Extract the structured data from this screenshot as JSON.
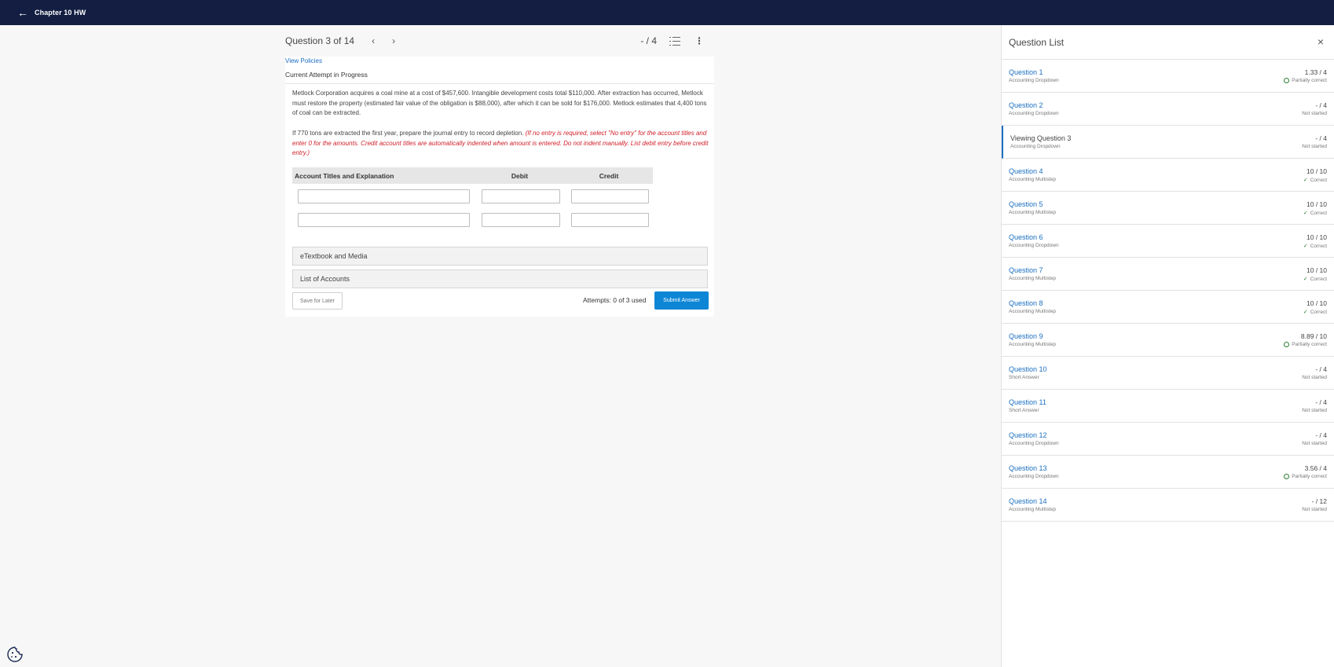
{
  "topbar": {
    "back_icon": "←",
    "title": "Chapter 10 HW"
  },
  "header": {
    "question_label": "Question 3 of 14",
    "prev_icon": "‹",
    "next_icon": "›",
    "score": "- / 4",
    "more_icon": "⋮"
  },
  "card": {
    "view_policies": "View Policies",
    "attempt_status": "Current Attempt in Progress",
    "question_text": "Metlock Corporation acquires a coal mine at a cost of $457,600. Intangible development costs total $110,000. After extraction has occurred, Metlock must restore the property (estimated fair value of the obligation is $88,000), after which it can be sold for $176,000. Metlock estimates that 4,400 tons of coal can be extracted.",
    "instruction_plain": "If 770 tons are extracted the first year, prepare the journal entry to record depletion.",
    "instruction_red": "(If no entry is required, select \"No entry\" for the account titles and enter 0 for the amounts. Credit account titles are automatically indented when amount is entered. Do not indent manually. List debit entry before credit entry.)",
    "table": {
      "col_account": "Account Titles and Explanation",
      "col_debit": "Debit",
      "col_credit": "Credit"
    },
    "etextbook": "eTextbook and Media",
    "list_accounts": "List of Accounts",
    "save_label": "Save for Later",
    "attempts": "Attempts: 0 of 3 used",
    "submit_label": "Submit Answer"
  },
  "panel": {
    "title": "Question List",
    "close_icon": "×",
    "items": [
      {
        "title": "Question 1",
        "type": "Accounting Dropdown",
        "score": "1.33 / 4",
        "status": "Partially correct",
        "status_icon": "partial"
      },
      {
        "title": "Question 2",
        "type": "Accounting Dropdown",
        "score": "- / 4",
        "status": "Not started",
        "status_icon": "none"
      },
      {
        "title": "Viewing Question 3",
        "type": "Accounting Dropdown",
        "score": "- / 4",
        "status": "Not started",
        "status_icon": "none"
      },
      {
        "title": "Question 4",
        "type": "Accounting Multistep",
        "score": "10 / 10",
        "status": "Correct",
        "status_icon": "check"
      },
      {
        "title": "Question 5",
        "type": "Accounting Multistep",
        "score": "10 / 10",
        "status": "Correct",
        "status_icon": "check"
      },
      {
        "title": "Question 6",
        "type": "Accounting Dropdown",
        "score": "10 / 10",
        "status": "Correct",
        "status_icon": "check"
      },
      {
        "title": "Question 7",
        "type": "Accounting Multistep",
        "score": "10 / 10",
        "status": "Correct",
        "status_icon": "check"
      },
      {
        "title": "Question 8",
        "type": "Accounting Multistep",
        "score": "10 / 10",
        "status": "Correct",
        "status_icon": "check"
      },
      {
        "title": "Question 9",
        "type": "Accounting Multistep",
        "score": "8.89 / 10",
        "status": "Partially correct",
        "status_icon": "partial"
      },
      {
        "title": "Question 10",
        "type": "Short Answer",
        "score": "- / 4",
        "status": "Not started",
        "status_icon": "none"
      },
      {
        "title": "Question 11",
        "type": "Short Answer",
        "score": "- / 4",
        "status": "Not started",
        "status_icon": "none"
      },
      {
        "title": "Question 12",
        "type": "Accounting Dropdown",
        "score": "- / 4",
        "status": "Not started",
        "status_icon": "none"
      },
      {
        "title": "Question 13",
        "type": "Accounting Dropdown",
        "score": "3.56 / 4",
        "status": "Partially correct",
        "status_icon": "partial"
      },
      {
        "title": "Question 14",
        "type": "Accounting Multistep",
        "score": "- / 12",
        "status": "Not started",
        "status_icon": "none"
      }
    ]
  },
  "colors": {
    "topbar": "#131e42",
    "link": "#1a6ec0",
    "submit": "#0e86d6",
    "instruction": "#d0202a",
    "correct": "#2e7d32"
  }
}
